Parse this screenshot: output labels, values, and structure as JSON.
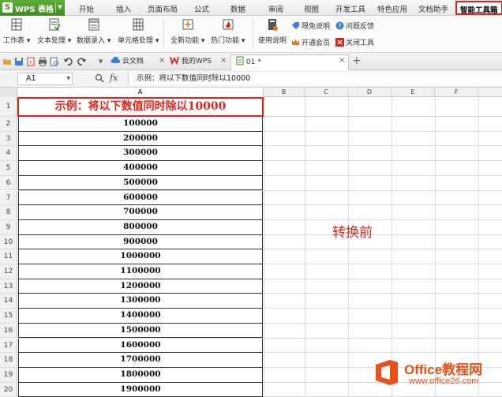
{
  "app": {
    "title": "WPS 表格",
    "menu_tabs": [
      "开始",
      "插入",
      "页面布局",
      "公式",
      "数据",
      "审阅",
      "视图",
      "开发工具",
      "特色应用",
      "文档助手",
      "智能工具箱"
    ],
    "active_tab": "智能工具箱",
    "accent_color": "#3f8d23",
    "highlight_color": "#e0241d"
  },
  "ribbon": {
    "groups": [
      {
        "label": "工作表 ▾",
        "icon": "worksheet-icon"
      },
      {
        "label": "文本处理 ▾",
        "icon": "text-process-icon"
      },
      {
        "label": "数据录入 ▾",
        "icon": "data-entry-icon"
      },
      {
        "label": "单元格处理 ▾",
        "icon": "cell-process-icon"
      },
      {
        "label": "全新功能 ▾",
        "icon": "new-feature-icon"
      },
      {
        "label": "热门功能 ▾",
        "icon": "hot-feature-icon"
      },
      {
        "label": "使用说明",
        "icon": "instructions-icon"
      }
    ],
    "small_items": [
      "限免说明",
      "问题反馈",
      "开通会员",
      "关闭工具"
    ]
  },
  "docbar": {
    "tabs": [
      "云文档",
      "我的WPS",
      "01 *"
    ],
    "active_tab": "01 *",
    "add_label": "+"
  },
  "formula_bar": {
    "cell_ref": "A1",
    "fx_label": "fx",
    "formula": "示例：将以下数值同时除以10000"
  },
  "sheet": {
    "columns": [
      "A",
      "B",
      "C",
      "D",
      "E",
      "F"
    ],
    "row_numbers": [
      "1",
      "2",
      "3",
      "4",
      "5",
      "6",
      "7",
      "8",
      "9",
      "10",
      "11",
      "12",
      "13",
      "14",
      "15",
      "16",
      "17",
      "18",
      "19",
      "20"
    ],
    "title_cell": "示例：将以下数值同时除以10000",
    "values": [
      "100000",
      "200000",
      "300000",
      "400000",
      "500000",
      "600000",
      "700000",
      "800000",
      "900000",
      "1000000",
      "1100000",
      "1200000",
      "1300000",
      "1400000",
      "1500000",
      "1600000",
      "1700000",
      "1800000",
      "1900000"
    ],
    "annotation": "转换前"
  },
  "watermark": {
    "brand": "Office教程网",
    "url": "www.office26.com"
  }
}
